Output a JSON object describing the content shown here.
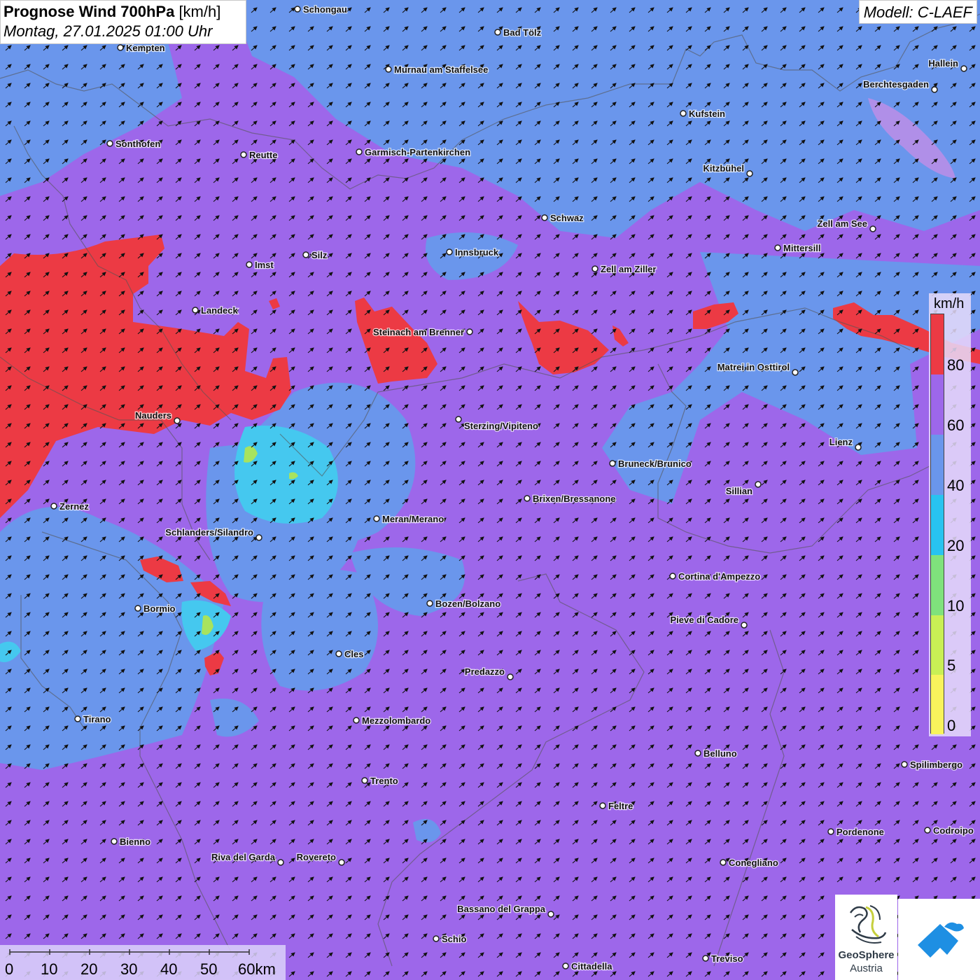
{
  "header": {
    "title_bold": "Prognose Wind 700hPa",
    "title_unit": "[km/h]",
    "datetime": "Montag, 27.01.2025 01:00 Uhr"
  },
  "model_label": "Modell: C-LAEF",
  "legend": {
    "unit": "km/h",
    "labels": [
      "80",
      "60",
      "40",
      "20",
      "10",
      "5",
      "0"
    ],
    "colors": [
      "#ec3a44",
      "#9d67ea",
      "#6a96ec",
      "#28c3f0",
      "#7fe27c",
      "#c9ef55",
      "#f8f35c"
    ]
  },
  "scalebar": {
    "labels": [
      "0",
      "10",
      "20",
      "30",
      "40",
      "50",
      "60km"
    ]
  },
  "logos": {
    "geosphere_name": "GeoSphere",
    "geosphere_sub": "Austria"
  },
  "cities": [
    {
      "name": "Schongau"
    },
    {
      "name": "Bad Tölz"
    },
    {
      "name": "Kempten"
    },
    {
      "name": "Murnau am Staffelsee"
    },
    {
      "name": "Hallein"
    },
    {
      "name": "Berchtesgaden"
    },
    {
      "name": "Kufstein"
    },
    {
      "name": "Sonthofen"
    },
    {
      "name": "Reutte"
    },
    {
      "name": "Garmisch-Partenkirchen"
    },
    {
      "name": "Kitzbühel"
    },
    {
      "name": "Schwaz"
    },
    {
      "name": "Zell am See"
    },
    {
      "name": "Mittersill"
    },
    {
      "name": "Innsbruck"
    },
    {
      "name": "Imst"
    },
    {
      "name": "Silz"
    },
    {
      "name": "Zell am Ziller"
    },
    {
      "name": "Landeck"
    },
    {
      "name": "Steinach am Brenner"
    },
    {
      "name": "Matrei in Osttirol"
    },
    {
      "name": "Nauders"
    },
    {
      "name": "Sterzing/Vipiteno"
    },
    {
      "name": "Lienz"
    },
    {
      "name": "Bruneck/Brunico"
    },
    {
      "name": "Sillian"
    },
    {
      "name": "Zernez"
    },
    {
      "name": "Brixen/Bressanone"
    },
    {
      "name": "Meran/Merano"
    },
    {
      "name": "Schlanders/Silandro"
    },
    {
      "name": "Cortina d'Ampezzo"
    },
    {
      "name": "Bormio"
    },
    {
      "name": "Bozen/Bolzano"
    },
    {
      "name": "Pieve di Cadore"
    },
    {
      "name": "Cles"
    },
    {
      "name": "Predazzo"
    },
    {
      "name": "Tirano"
    },
    {
      "name": "Mezzolombardo"
    },
    {
      "name": "Belluno"
    },
    {
      "name": "Spilimbergo"
    },
    {
      "name": "Trento"
    },
    {
      "name": "Feltre"
    },
    {
      "name": "Pordenone"
    },
    {
      "name": "Codroipo"
    },
    {
      "name": "Bienno"
    },
    {
      "name": "Riva del Garda"
    },
    {
      "name": "Rovereto"
    },
    {
      "name": "Conegliano"
    },
    {
      "name": "Bassano del Grappa"
    },
    {
      "name": "Schio"
    },
    {
      "name": "Treviso"
    },
    {
      "name": "Cittadella"
    }
  ]
}
